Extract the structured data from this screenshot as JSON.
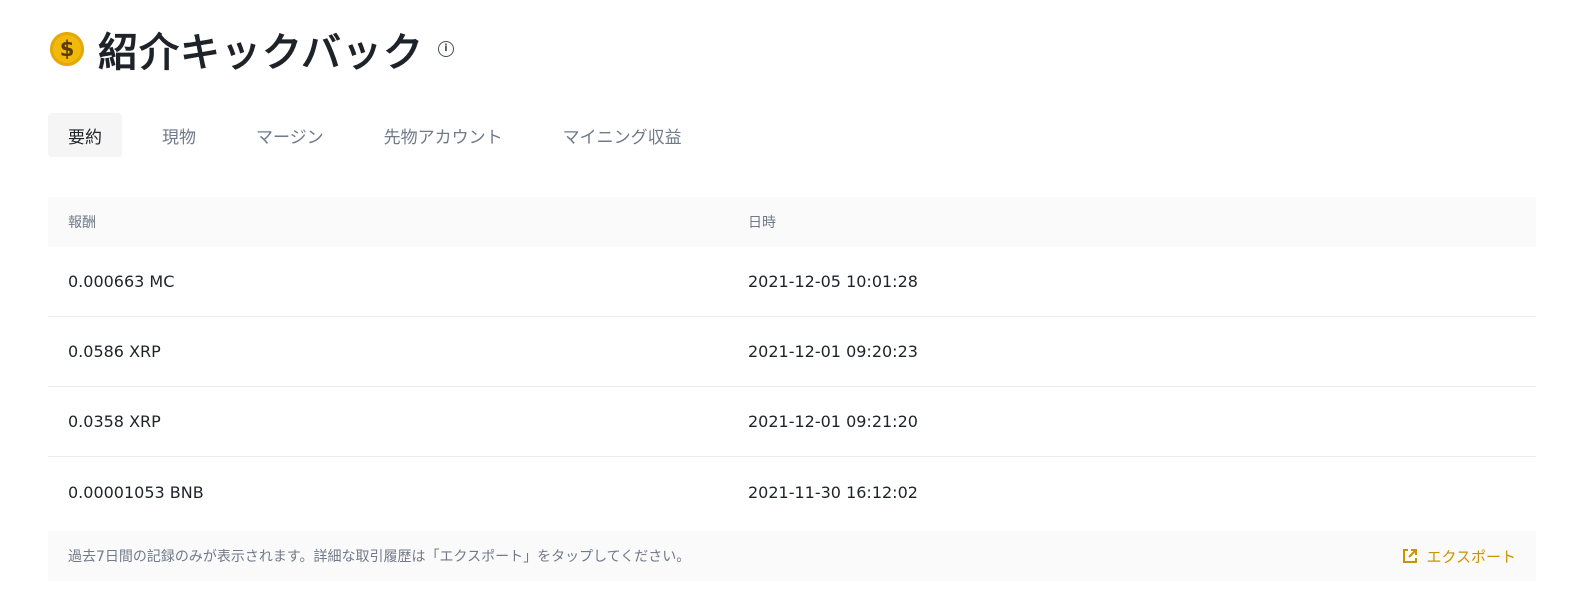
{
  "header": {
    "coin_symbol": "$",
    "title": "紹介キックバック",
    "info_icon": "i"
  },
  "tabs": [
    {
      "label": "要約",
      "active": true
    },
    {
      "label": "現物",
      "active": false
    },
    {
      "label": "マージン",
      "active": false
    },
    {
      "label": "先物アカウント",
      "active": false
    },
    {
      "label": "マイニング収益",
      "active": false
    }
  ],
  "table": {
    "headers": [
      "報酬",
      "日時"
    ],
    "rows": [
      {
        "reward": "0.000663 MC",
        "datetime": "2021-12-05 10:01:28"
      },
      {
        "reward": "0.0586 XRP",
        "datetime": "2021-12-01 09:20:23"
      },
      {
        "reward": "0.0358 XRP",
        "datetime": "2021-12-01 09:21:20"
      },
      {
        "reward": "0.00001053 BNB",
        "datetime": "2021-11-30 16:12:02"
      }
    ]
  },
  "footer": {
    "note": "過去7日間の記録のみが表示されます。詳細な取引履歴は「エクスポート」をタップしてください。",
    "export_label": "エクスポート"
  },
  "colors": {
    "accent": "#c99400",
    "coin": "#f0b90b",
    "text_primary": "#1e2329",
    "text_secondary": "#707a8a"
  }
}
